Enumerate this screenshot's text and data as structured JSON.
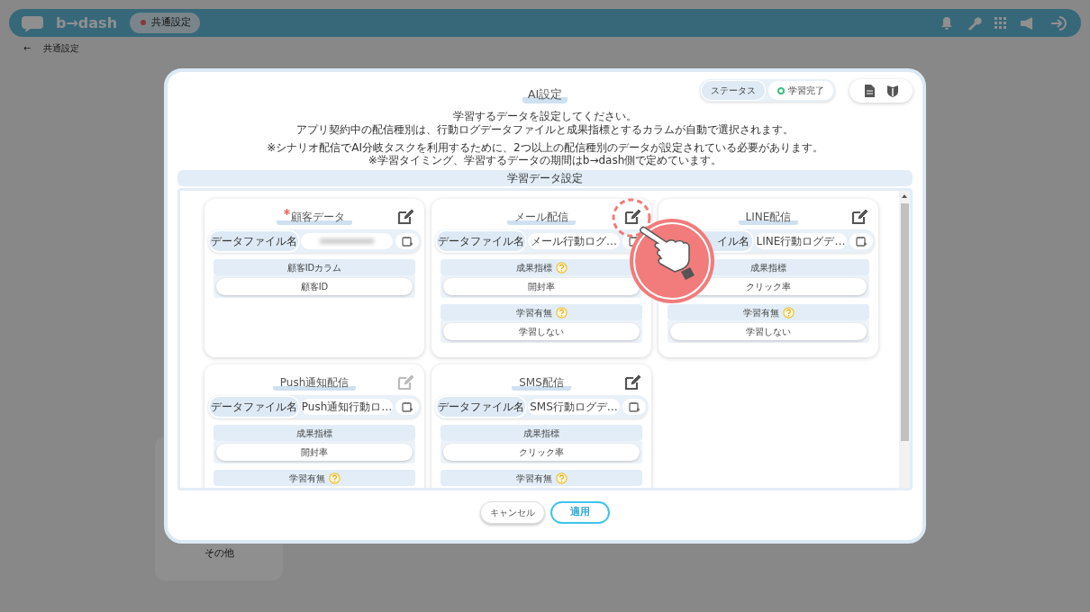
{
  "app_bar": {
    "logo": "b→dash",
    "section": "共通設定"
  },
  "breadcrumb": {
    "back": "←",
    "label": "共通設定"
  },
  "sidebar": {
    "items": [
      "その他"
    ]
  },
  "dialog": {
    "title": "AI設定",
    "status": {
      "label": "ステータス",
      "value": "学習完了"
    },
    "description": [
      "学習するデータを設定してください。",
      "アプリ契約中の配信種別は、行動ログデータファイルと成果指標とするカラムが自動で選択されます。"
    ],
    "notes": [
      "※シナリオ配信でAI分岐タスクを利用するために、2つ以上の配信種別のデータが設定されている必要があります。",
      "※学習タイミング、学習するデータの期間はb→dash側で定めています。"
    ],
    "section_title": "学習データ設定",
    "cards": [
      {
        "title": "顧客データ",
        "required": true,
        "edit_disabled": false,
        "highlighted": false,
        "file_label": "データファイル名",
        "file_value_hidden": true,
        "fields": [
          {
            "label": "顧客IDカラム",
            "help": false,
            "value": "顧客ID"
          }
        ]
      },
      {
        "title": "メール配信",
        "required": false,
        "edit_disabled": false,
        "highlighted": true,
        "file_label": "データファイル名",
        "file_value": "メール行動ログ…",
        "fields": [
          {
            "label": "成果指標",
            "help": true,
            "value": "開封率"
          },
          {
            "label": "学習有無",
            "help": true,
            "value": "学習しない"
          }
        ]
      },
      {
        "title": "LINE配信",
        "required": false,
        "edit_disabled": false,
        "highlighted": false,
        "file_label": "イル名",
        "file_value": "LINE行動ログデ…",
        "fields": [
          {
            "label": "成果指標",
            "help": false,
            "value": "クリック率"
          },
          {
            "label": "学習有無",
            "help": true,
            "value": "学習しない"
          }
        ]
      },
      {
        "title": "Push通知配信",
        "required": false,
        "edit_disabled": true,
        "highlighted": false,
        "file_label": "データファイル名",
        "file_value": "Push通知行動ロ…",
        "fields": [
          {
            "label": "成果指標",
            "help": false,
            "value": "開封率"
          },
          {
            "label": "学習有無",
            "help": true
          }
        ]
      },
      {
        "title": "SMS配信",
        "required": false,
        "edit_disabled": false,
        "highlighted": false,
        "file_label": "データファイル名",
        "file_value": "SMS行動ログデ…",
        "fields": [
          {
            "label": "成果指標",
            "help": false,
            "value": "クリック率"
          },
          {
            "label": "学習有無",
            "help": true
          }
        ]
      }
    ],
    "buttons": [
      {
        "label": "キャンセル",
        "kind": "secondary"
      },
      {
        "label": "適用",
        "kind": "primary"
      }
    ]
  }
}
